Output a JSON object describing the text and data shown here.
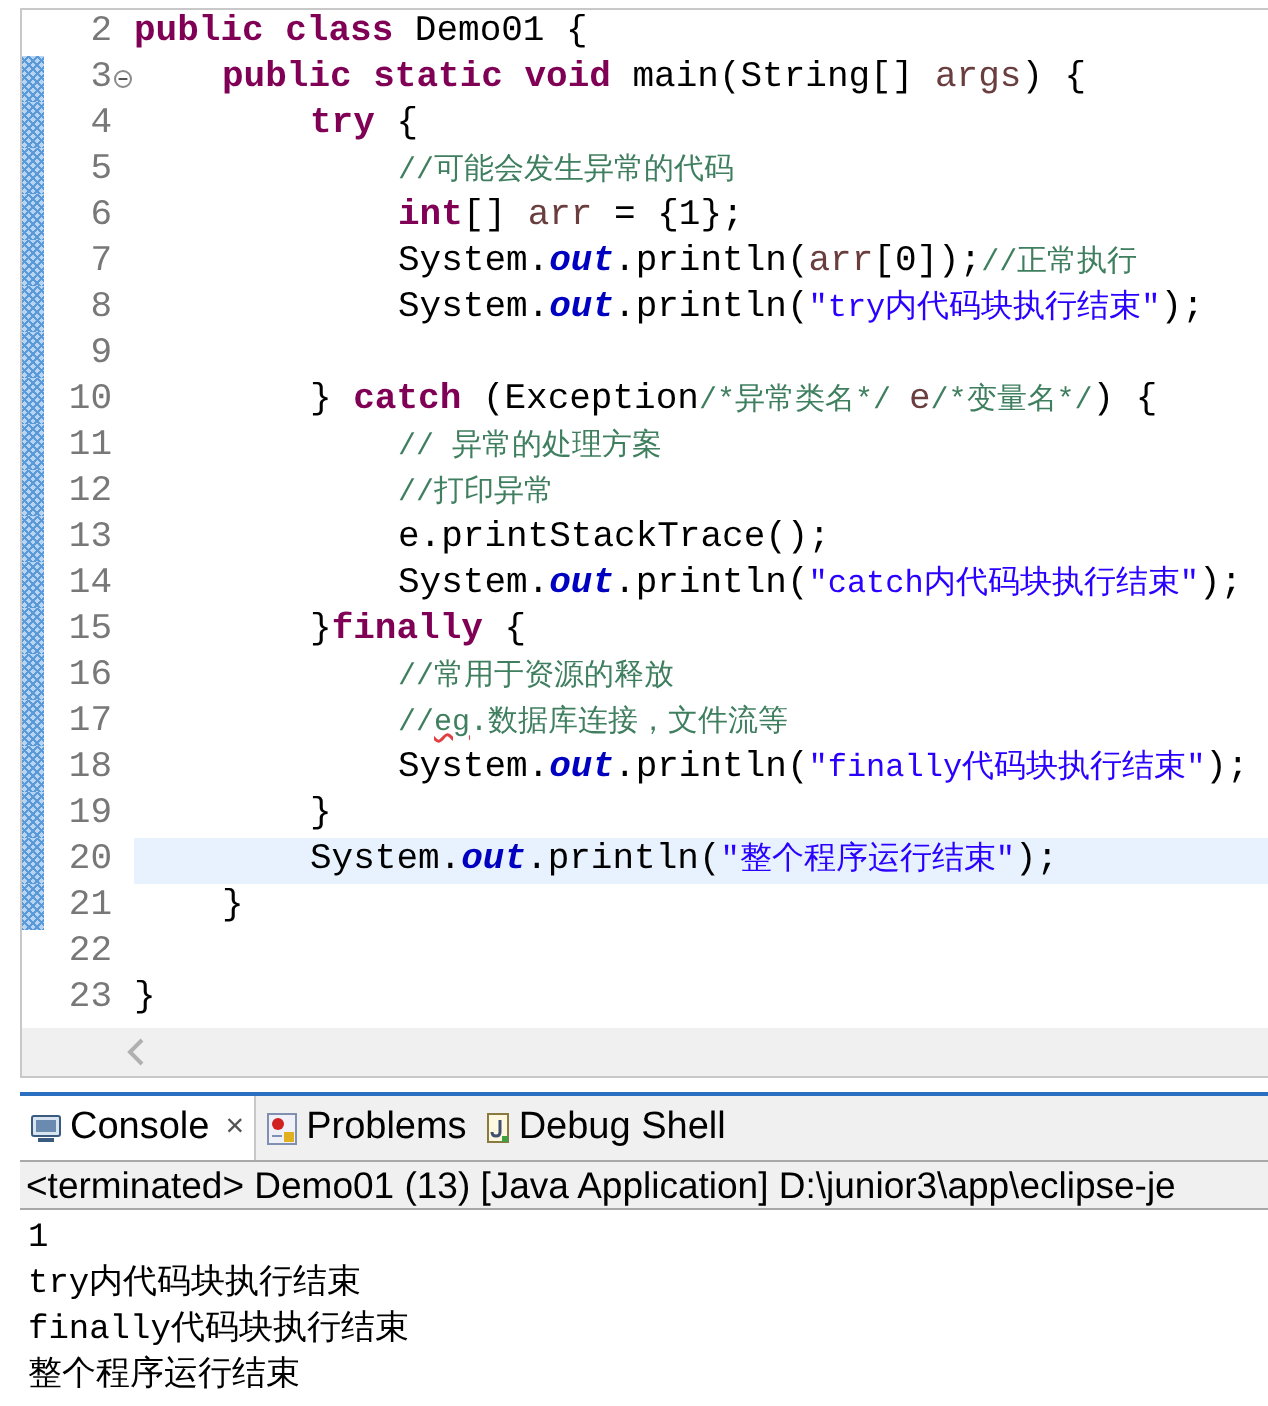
{
  "editor": {
    "lines": [
      {
        "number": "2",
        "fold": false,
        "changed": false,
        "current": false,
        "tokens": [
          {
            "kind": "keyword",
            "text": "public class"
          },
          {
            "kind": "plain",
            "text": " Demo01 {"
          }
        ],
        "children": [
          {
            "number": "3",
            "fold": true,
            "changed": true,
            "current": false,
            "tokens": [
              {
                "kind": "keyword",
                "text": "public static void"
              },
              {
                "kind": "plain",
                "text": " main(String[] "
              },
              {
                "kind": "variable",
                "text": "args"
              },
              {
                "kind": "plain",
                "text": ") {"
              }
            ],
            "children": [
              {
                "number": "4",
                "fold": false,
                "changed": true,
                "current": false,
                "tokens": [
                  {
                    "kind": "keyword",
                    "text": "try"
                  },
                  {
                    "kind": "plain",
                    "text": " {"
                  }
                ],
                "children": [
                  {
                    "number": "5",
                    "fold": false,
                    "changed": true,
                    "current": false,
                    "tokens": [
                      {
                        "kind": "comment",
                        "text": "//可能会发生异常的代码"
                      }
                    ]
                  },
                  {
                    "number": "6",
                    "fold": false,
                    "changed": true,
                    "current": false,
                    "tokens": [
                      {
                        "kind": "keyword",
                        "text": "int"
                      },
                      {
                        "kind": "plain",
                        "text": "[] "
                      },
                      {
                        "kind": "variable",
                        "text": "arr"
                      },
                      {
                        "kind": "plain",
                        "text": " = {1};"
                      }
                    ]
                  },
                  {
                    "number": "7",
                    "fold": false,
                    "changed": true,
                    "current": false,
                    "tokens": [
                      {
                        "kind": "plain",
                        "text": "System."
                      },
                      {
                        "kind": "field",
                        "text": "out"
                      },
                      {
                        "kind": "plain",
                        "text": ".println("
                      },
                      {
                        "kind": "variable",
                        "text": "arr"
                      },
                      {
                        "kind": "plain",
                        "text": "[0]);"
                      },
                      {
                        "kind": "comment",
                        "text": "//正常执行"
                      }
                    ]
                  },
                  {
                    "number": "8",
                    "fold": false,
                    "changed": true,
                    "current": false,
                    "tokens": [
                      {
                        "kind": "plain",
                        "text": "System."
                      },
                      {
                        "kind": "field",
                        "text": "out"
                      },
                      {
                        "kind": "plain",
                        "text": ".println("
                      },
                      {
                        "kind": "string",
                        "text": "\"try内代码块执行结束\""
                      },
                      {
                        "kind": "plain",
                        "text": ");"
                      }
                    ]
                  },
                  {
                    "number": "9",
                    "fold": false,
                    "changed": true,
                    "current": false
                  }
                ]
              },
              {
                "number": "10",
                "fold": false,
                "changed": true,
                "current": false,
                "tokens": [
                  {
                    "kind": "plain",
                    "text": "} "
                  },
                  {
                    "kind": "keyword",
                    "text": "catch"
                  },
                  {
                    "kind": "plain",
                    "text": " (Exception"
                  },
                  {
                    "kind": "comment",
                    "text": "/*异常类名*/ "
                  },
                  {
                    "kind": "variable",
                    "text": "e"
                  },
                  {
                    "kind": "comment",
                    "text": "/*变量名*/"
                  },
                  {
                    "kind": "plain",
                    "text": ") {"
                  }
                ],
                "children": [
                  {
                    "number": "11",
                    "fold": false,
                    "changed": true,
                    "current": false,
                    "tokens": [
                      {
                        "kind": "comment",
                        "text": "// 异常的处理方案"
                      }
                    ]
                  },
                  {
                    "number": "12",
                    "fold": false,
                    "changed": true,
                    "current": false,
                    "tokens": [
                      {
                        "kind": "comment",
                        "text": "//打印异常"
                      }
                    ]
                  },
                  {
                    "number": "13",
                    "fold": false,
                    "changed": true,
                    "current": false,
                    "tokens": [
                      {
                        "kind": "plain",
                        "text": "e.printStackTrace();"
                      }
                    ]
                  },
                  {
                    "number": "14",
                    "fold": false,
                    "changed": true,
                    "current": false,
                    "tokens": [
                      {
                        "kind": "plain",
                        "text": "System."
                      },
                      {
                        "kind": "field",
                        "text": "out"
                      },
                      {
                        "kind": "plain",
                        "text": ".println("
                      },
                      {
                        "kind": "string",
                        "text": "\"catch内代码块执行结束\""
                      },
                      {
                        "kind": "plain",
                        "text": ");"
                      }
                    ]
                  }
                ]
              },
              {
                "number": "15",
                "fold": false,
                "changed": true,
                "current": false,
                "tokens": [
                  {
                    "kind": "plain",
                    "text": "}"
                  },
                  {
                    "kind": "keyword",
                    "text": "finally"
                  },
                  {
                    "kind": "plain",
                    "text": " {"
                  }
                ],
                "children": [
                  {
                    "number": "16",
                    "fold": false,
                    "changed": true,
                    "current": false,
                    "tokens": [
                      {
                        "kind": "comment",
                        "text": "//常用于资源的释放"
                      }
                    ]
                  },
                  {
                    "number": "17",
                    "fold": false,
                    "changed": true,
                    "current": false,
                    "tokens": [
                      {
                        "kind": "comment",
                        "text": "//"
                      },
                      {
                        "kind": "typo",
                        "text": "eg"
                      },
                      {
                        "kind": "comment",
                        "text": ".数据库连接，文件流等"
                      }
                    ]
                  },
                  {
                    "number": "18",
                    "fold": false,
                    "changed": true,
                    "current": false,
                    "tokens": [
                      {
                        "kind": "plain",
                        "text": "System."
                      },
                      {
                        "kind": "field",
                        "text": "out"
                      },
                      {
                        "kind": "plain",
                        "text": ".println("
                      },
                      {
                        "kind": "string",
                        "text": "\"finally代码块执行结束\""
                      },
                      {
                        "kind": "plain",
                        "text": ");"
                      }
                    ]
                  }
                ]
              },
              {
                "number": "19",
                "fold": false,
                "changed": true,
                "current": false,
                "tokens": [
                  {
                    "kind": "plain",
                    "text": "}"
                  }
                ]
              },
              {
                "number": "20",
                "fold": false,
                "changed": true,
                "current": true,
                "tokens": [
                  {
                    "kind": "plain",
                    "text": "System."
                  },
                  {
                    "kind": "field",
                    "text": "out"
                  },
                  {
                    "kind": "plain",
                    "text": ".println("
                  },
                  {
                    "kind": "string",
                    "text": "\"整个程序运行结束\""
                  },
                  {
                    "kind": "plain",
                    "text": ");"
                  }
                ]
              }
            ]
          },
          {
            "number": "21",
            "fold": false,
            "changed": true,
            "current": false,
            "tokens": [
              {
                "kind": "plain",
                "text": "}"
              }
            ]
          }
        ]
      },
      {
        "number": "22",
        "fold": false,
        "changed": false,
        "current": false
      },
      {
        "number": "23",
        "fold": false,
        "changed": false,
        "current": false,
        "tokens": [
          {
            "kind": "plain",
            "text": "}"
          }
        ]
      }
    ]
  },
  "console": {
    "tabs": [
      {
        "label": "Console",
        "selected": true,
        "closable": true
      },
      {
        "label": "Problems",
        "selected": false,
        "closable": false
      },
      {
        "label": "Debug Shell",
        "selected": false,
        "closable": false
      }
    ],
    "close_glyph": "×",
    "status": "<terminated> Demo01 (13) [Java Application] D:\\junior3\\app\\eclipse-je",
    "output": [
      "1",
      "try内代码块执行结束",
      "finally代码块执行结束",
      "整个程序运行结束"
    ]
  }
}
